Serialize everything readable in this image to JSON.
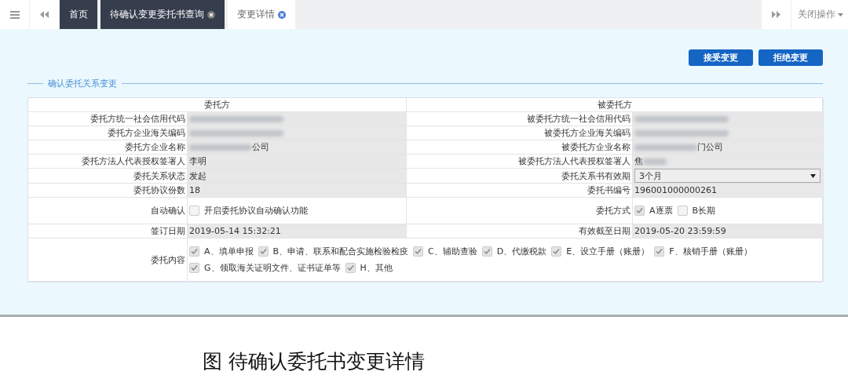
{
  "tabs": [
    {
      "label": "首页",
      "selected": false,
      "closable": false
    },
    {
      "label": "待确认变更委托书查询",
      "selected": false,
      "closable": true
    },
    {
      "label": "变更详情",
      "selected": true,
      "closable": true
    }
  ],
  "close_menu": "关闭操作",
  "buttons": [
    "接受变更",
    "拒绝变更"
  ],
  "section_title": "确认委托关系变更",
  "table": {
    "headers": [
      "委托方",
      "被委托方"
    ],
    "rows": [
      [
        {
          "label": "委托方统一社会信用代码",
          "kind": "text",
          "blur_before": true
        },
        {
          "label": "被委托方统一社会信用代码",
          "kind": "text",
          "blur_before": true
        }
      ],
      [
        {
          "label": "委托方企业海关编码",
          "kind": "text",
          "blur_before": true
        },
        {
          "label": "被委托方企业海关编码",
          "kind": "text",
          "blur_before": true
        }
      ],
      [
        {
          "label": "委托方企业名称",
          "kind": "text",
          "blur_before": true,
          "value": "公司"
        },
        {
          "label": "被委托方企业名称",
          "kind": "text",
          "blur_before": true,
          "value": "门公司"
        }
      ],
      [
        {
          "label": "委托方法人代表授权签署人",
          "kind": "text",
          "value": "李明"
        },
        {
          "label": "被委托方法人代表授权签署人",
          "kind": "text",
          "blur_after": true,
          "value": "焦"
        }
      ],
      [
        {
          "label": "委托关系状态",
          "kind": "text",
          "value": "发起"
        },
        {
          "label": "委托关系书有效期",
          "kind": "select",
          "value": "3个月"
        }
      ],
      [
        {
          "label": "委托协议份数",
          "kind": "text",
          "value": "18"
        },
        {
          "label": "委托书编号",
          "kind": "text",
          "value": "196001000000261"
        }
      ],
      [
        {
          "label": "自动确认",
          "kind": "checks",
          "options": [
            {
              "label": "开启委托协议自动确认功能",
              "checked": false
            }
          ]
        },
        {
          "label": "委托方式",
          "kind": "checks",
          "options": [
            {
              "label": "A逐票",
              "checked": true
            },
            {
              "label": "B长期",
              "checked": false
            }
          ]
        }
      ],
      [
        {
          "label": "签订日期",
          "kind": "text",
          "value": "2019-05-14 15:32:21"
        },
        {
          "label": "有效截至日期",
          "kind": "text",
          "value": "2019-05-20 23:59:59"
        }
      ]
    ],
    "content": {
      "label": "委托内容",
      "options": [
        {
          "label": "A、填单申报",
          "checked": true
        },
        {
          "label": "B、申请、联系和配合实施检验检疫",
          "checked": true
        },
        {
          "label": "C、辅助查验",
          "checked": true
        },
        {
          "label": "D、代缴税款",
          "checked": true
        },
        {
          "label": "E、设立手册（账册）",
          "checked": true
        },
        {
          "label": "F、核销手册（账册）",
          "checked": true
        },
        {
          "label": "G、领取海关证明文件、证书证单等",
          "checked": true
        },
        {
          "label": "H、其他",
          "checked": true
        }
      ]
    }
  },
  "caption": "图  待确认委托书变更详情"
}
